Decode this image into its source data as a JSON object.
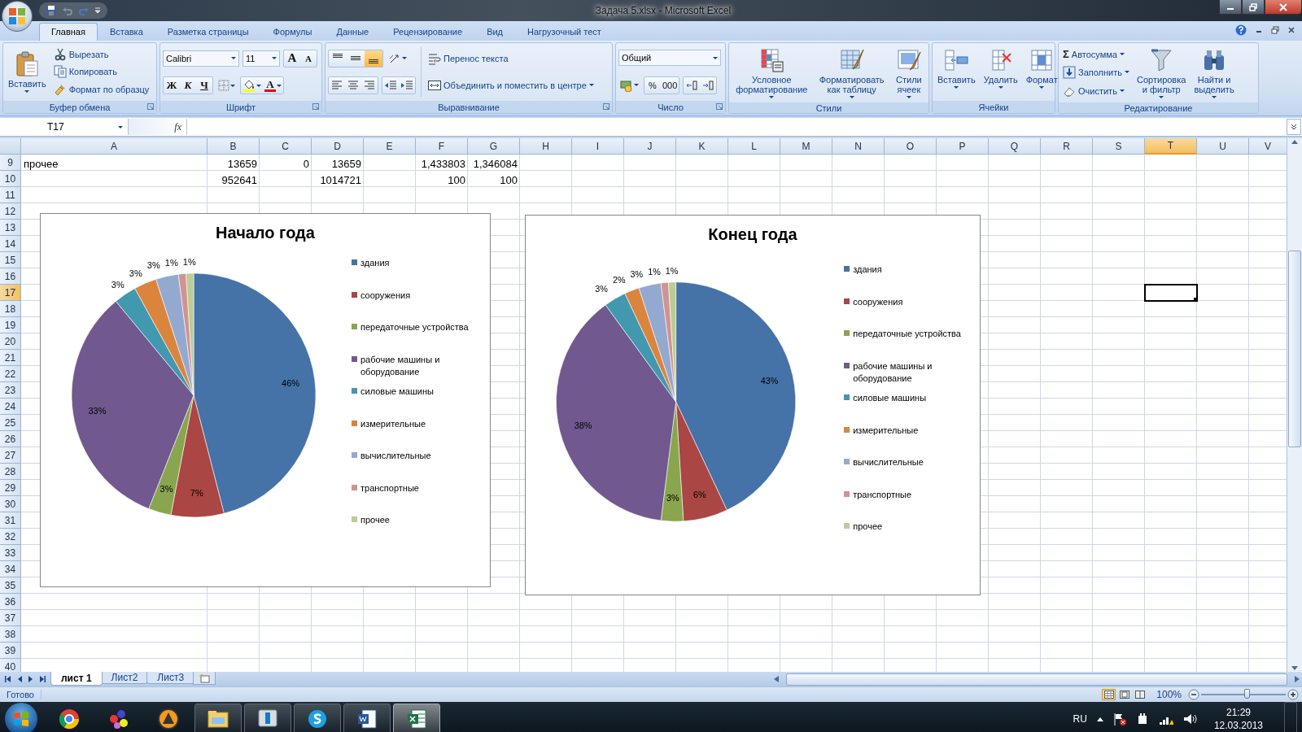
{
  "window": {
    "title": "Задача 5.xlsx - Microsoft Excel"
  },
  "ribbon_tabs": [
    {
      "label": "Главная",
      "selected": true
    },
    {
      "label": "Вставка",
      "selected": false
    },
    {
      "label": "Разметка страницы",
      "selected": false
    },
    {
      "label": "Формулы",
      "selected": false
    },
    {
      "label": "Данные",
      "selected": false
    },
    {
      "label": "Рецензирование",
      "selected": false
    },
    {
      "label": "Вид",
      "selected": false
    },
    {
      "label": "Нагрузочный тест",
      "selected": false
    }
  ],
  "ribbon_groups": [
    {
      "kind": "clipboard",
      "label": "Буфер обмена",
      "dialog_launcher": true,
      "big_button": "Вставить",
      "buttons": [
        "Вырезать",
        "Копировать",
        "Формат по образцу"
      ]
    },
    {
      "kind": "font",
      "label": "Шрифт",
      "dialog_launcher": true,
      "font_name": "Calibri",
      "font_size": "11",
      "grow": "A",
      "shrink": "A",
      "styles": [
        "Ж",
        "К",
        "Ч"
      ],
      "font_color": "A"
    },
    {
      "kind": "alignment",
      "label": "Выравнивание",
      "dialog_launcher": true,
      "vertical_align": [
        {
          "selected": false
        },
        {
          "selected": false
        },
        {
          "selected": true
        }
      ],
      "buttons": [
        "Перенос текста",
        "Объединить и поместить в центре"
      ]
    },
    {
      "kind": "number",
      "label": "Число",
      "dialog_launcher": true,
      "format": "Общий",
      "buttons": [
        "%",
        "000"
      ]
    },
    {
      "kind": "large",
      "label": "Стили",
      "dialog_launcher": false,
      "items": [
        {
          "lines": [
            "Условное",
            "форматирование"
          ]
        },
        {
          "lines": [
            "Форматировать",
            "как таблицу"
          ]
        },
        {
          "lines": [
            "Стили",
            "ячеек"
          ]
        }
      ]
    },
    {
      "kind": "large",
      "label": "Ячейки",
      "dialog_launcher": false,
      "items": [
        {
          "lines": [
            "Вставить"
          ]
        },
        {
          "lines": [
            "Удалить"
          ]
        },
        {
          "lines": [
            "Формат"
          ]
        }
      ]
    },
    {
      "kind": "editing",
      "label": "Редактирование",
      "dialog_launcher": false,
      "buttons": [
        {
          "label": "Автосумма",
          "glyph": "Σ"
        },
        {
          "label": "Заполнить"
        },
        {
          "label": "Очистить"
        }
      ],
      "items": [
        {
          "lines": [
            "Сортировка",
            "и фильтр"
          ]
        },
        {
          "lines": [
            "Найти и",
            "выделить"
          ]
        }
      ]
    }
  ],
  "formula_bar": {
    "name_box": "T17",
    "fx": "fx"
  },
  "sheet": {
    "columns": [
      {
        "label": "A",
        "selected": false
      },
      {
        "label": "B",
        "selected": false
      },
      {
        "label": "C",
        "selected": false
      },
      {
        "label": "D",
        "selected": false
      },
      {
        "label": "E",
        "selected": false
      },
      {
        "label": "F",
        "selected": false
      },
      {
        "label": "G",
        "selected": false
      },
      {
        "label": "H",
        "selected": false
      },
      {
        "label": "I",
        "selected": false
      },
      {
        "label": "J",
        "selected": false
      },
      {
        "label": "K",
        "selected": false
      },
      {
        "label": "L",
        "selected": false
      },
      {
        "label": "M",
        "selected": false
      },
      {
        "label": "N",
        "selected": false
      },
      {
        "label": "O",
        "selected": false
      },
      {
        "label": "P",
        "selected": false
      },
      {
        "label": "Q",
        "selected": false
      },
      {
        "label": "R",
        "selected": false
      },
      {
        "label": "S",
        "selected": false
      },
      {
        "label": "T",
        "selected": true
      },
      {
        "label": "U",
        "selected": false
      },
      {
        "label": "V",
        "selected": false
      }
    ],
    "rows": [
      {
        "number": "9",
        "selected": false,
        "cells": [
          {
            "text": "прочее",
            "kind": "text"
          },
          {
            "text": "13659",
            "kind": "number"
          },
          {
            "text": "0",
            "kind": "number"
          },
          {
            "text": "13659",
            "kind": "number"
          },
          null,
          {
            "text": "1,433803",
            "kind": "number"
          },
          {
            "text": "1,346084",
            "kind": "number"
          }
        ]
      },
      {
        "number": "10",
        "selected": false,
        "cells": [
          null,
          {
            "text": "952641",
            "kind": "number"
          },
          null,
          {
            "text": "1014721",
            "kind": "number"
          },
          null,
          {
            "text": "100",
            "kind": "number"
          },
          {
            "text": "100",
            "kind": "number"
          }
        ]
      },
      {
        "number": "11",
        "selected": false
      },
      {
        "number": "12",
        "selected": false
      },
      {
        "number": "13",
        "selected": false
      },
      {
        "number": "14",
        "selected": false
      },
      {
        "number": "15",
        "selected": false
      },
      {
        "number": "16",
        "selected": false
      },
      {
        "number": "17",
        "selected": true
      },
      {
        "number": "18",
        "selected": false
      },
      {
        "number": "19",
        "selected": false
      },
      {
        "number": "20",
        "selected": false
      },
      {
        "number": "21",
        "selected": false
      },
      {
        "number": "22",
        "selected": false
      },
      {
        "number": "23",
        "selected": false
      },
      {
        "number": "24",
        "selected": false
      },
      {
        "number": "25",
        "selected": false
      },
      {
        "number": "26",
        "selected": false
      },
      {
        "number": "27",
        "selected": false
      },
      {
        "number": "28",
        "selected": false
      },
      {
        "number": "29",
        "selected": false
      },
      {
        "number": "30",
        "selected": false
      },
      {
        "number": "31",
        "selected": false
      },
      {
        "number": "32",
        "selected": false
      },
      {
        "number": "33",
        "selected": false
      },
      {
        "number": "34",
        "selected": false
      },
      {
        "number": "35",
        "selected": false
      },
      {
        "number": "36",
        "selected": false
      },
      {
        "number": "37",
        "selected": false
      },
      {
        "number": "38",
        "selected": false
      },
      {
        "number": "39",
        "selected": false
      },
      {
        "number": "40",
        "selected": false
      }
    ]
  },
  "charts": [
    {
      "chart_data": {
        "type": "pie",
        "title": "Начало года",
        "categories": [
          "здания",
          "сооружения",
          "передаточные устройства",
          "рабочие машины и оборудование",
          "силовые машины",
          "измерительные",
          "вычислительные",
          "транспортные",
          "прочее"
        ],
        "values": [
          46,
          7,
          3,
          33,
          3,
          3,
          3,
          1,
          1
        ],
        "value_labels": [
          "46%",
          "7%",
          "3%",
          "33%",
          "3%",
          "3%",
          "3%",
          "1%",
          "1%"
        ],
        "legend": "right",
        "colors": [
          "#4572a7",
          "#aa4643",
          "#89a54e",
          "#71588f",
          "#4198af",
          "#db843d",
          "#93a9cf",
          "#d19392",
          "#b9cd96"
        ]
      }
    },
    {
      "chart_data": {
        "type": "pie",
        "title": "Конец года",
        "categories": [
          "здания",
          "сооружения",
          "передаточные устройства",
          "рабочие машины и оборудование",
          "силовые машины",
          "измерительные",
          "вычислительные",
          "транспортные",
          "прочее"
        ],
        "values": [
          43,
          6,
          3,
          38,
          3,
          2,
          3,
          1,
          1
        ],
        "value_labels": [
          "43%",
          "6%",
          "3%",
          "38%",
          "3%",
          "2%",
          "3%",
          "1%",
          "1%"
        ],
        "legend": "right",
        "colors": [
          "#4572a7",
          "#aa4643",
          "#89a54e",
          "#71588f",
          "#4198af",
          "#db843d",
          "#93a9cf",
          "#d19392",
          "#b9cd96"
        ]
      }
    }
  ],
  "sheet_tabs": [
    {
      "label": "лист 1",
      "selected": true
    },
    {
      "label": "Лист2",
      "selected": false
    },
    {
      "label": "Лист3",
      "selected": false
    }
  ],
  "status_bar": {
    "status": "Готово",
    "views": [
      {
        "selected": true
      },
      {
        "selected": false
      },
      {
        "selected": false
      }
    ],
    "zoom": "100%",
    "zoom_slider": {
      "level": 0.55
    }
  },
  "taskbar": {
    "apps": [
      {
        "kind": "chrome",
        "running": false,
        "selected": false
      },
      {
        "kind": "balls",
        "running": false,
        "selected": false
      },
      {
        "kind": "aimp",
        "running": false,
        "selected": false
      },
      {
        "kind": "folder",
        "running": true,
        "selected": false
      },
      {
        "kind": "monitor",
        "running": true,
        "selected": false
      },
      {
        "kind": "skype",
        "running": true,
        "selected": false
      },
      {
        "kind": "word",
        "running": true,
        "selected": false
      },
      {
        "kind": "excel",
        "running": true,
        "selected": true
      }
    ],
    "language": "RU",
    "time": "21:29",
    "date": "12.03.2013"
  }
}
